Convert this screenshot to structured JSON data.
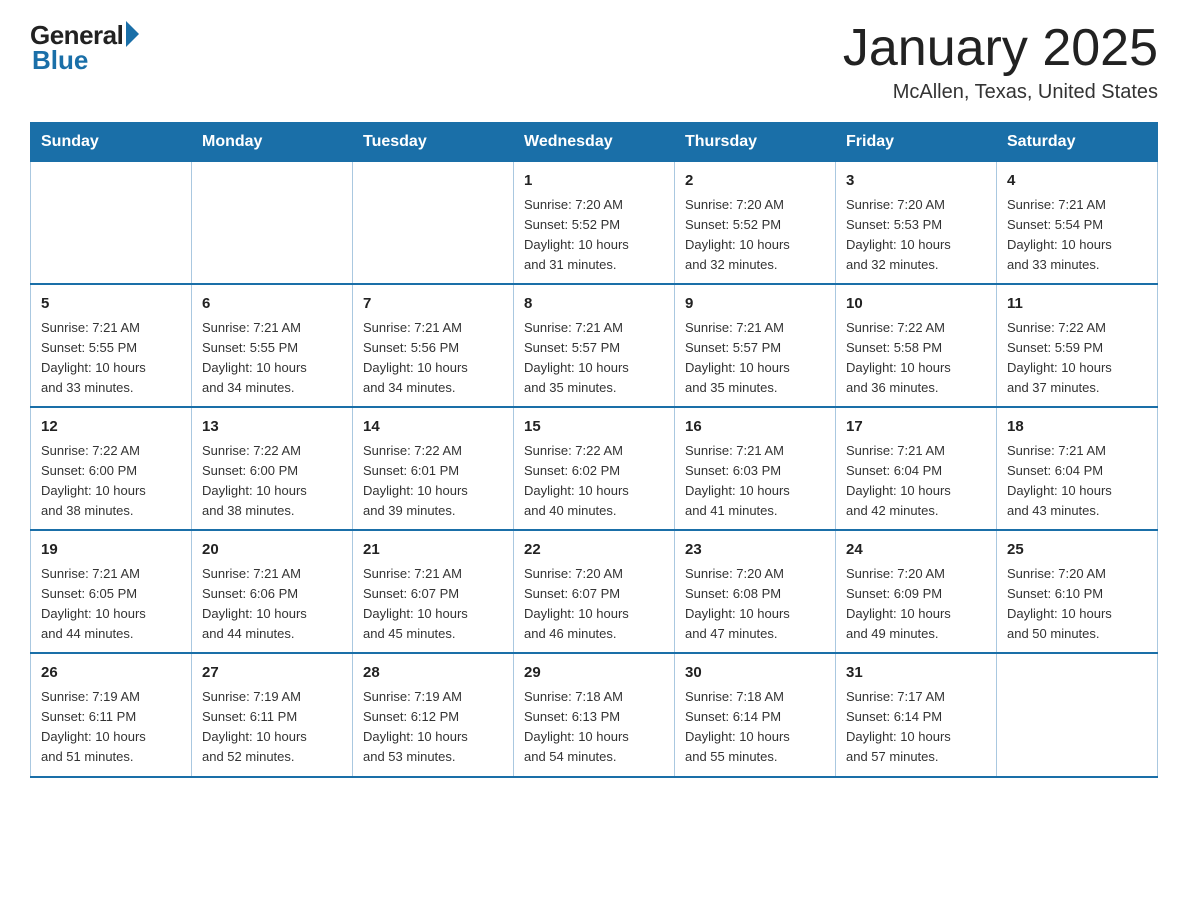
{
  "header": {
    "logo_general": "General",
    "logo_blue": "Blue",
    "main_title": "January 2025",
    "subtitle": "McAllen, Texas, United States"
  },
  "weekdays": [
    "Sunday",
    "Monday",
    "Tuesday",
    "Wednesday",
    "Thursday",
    "Friday",
    "Saturday"
  ],
  "weeks": [
    [
      {
        "day": "",
        "info": ""
      },
      {
        "day": "",
        "info": ""
      },
      {
        "day": "",
        "info": ""
      },
      {
        "day": "1",
        "info": "Sunrise: 7:20 AM\nSunset: 5:52 PM\nDaylight: 10 hours\nand 31 minutes."
      },
      {
        "day": "2",
        "info": "Sunrise: 7:20 AM\nSunset: 5:52 PM\nDaylight: 10 hours\nand 32 minutes."
      },
      {
        "day": "3",
        "info": "Sunrise: 7:20 AM\nSunset: 5:53 PM\nDaylight: 10 hours\nand 32 minutes."
      },
      {
        "day": "4",
        "info": "Sunrise: 7:21 AM\nSunset: 5:54 PM\nDaylight: 10 hours\nand 33 minutes."
      }
    ],
    [
      {
        "day": "5",
        "info": "Sunrise: 7:21 AM\nSunset: 5:55 PM\nDaylight: 10 hours\nand 33 minutes."
      },
      {
        "day": "6",
        "info": "Sunrise: 7:21 AM\nSunset: 5:55 PM\nDaylight: 10 hours\nand 34 minutes."
      },
      {
        "day": "7",
        "info": "Sunrise: 7:21 AM\nSunset: 5:56 PM\nDaylight: 10 hours\nand 34 minutes."
      },
      {
        "day": "8",
        "info": "Sunrise: 7:21 AM\nSunset: 5:57 PM\nDaylight: 10 hours\nand 35 minutes."
      },
      {
        "day": "9",
        "info": "Sunrise: 7:21 AM\nSunset: 5:57 PM\nDaylight: 10 hours\nand 35 minutes."
      },
      {
        "day": "10",
        "info": "Sunrise: 7:22 AM\nSunset: 5:58 PM\nDaylight: 10 hours\nand 36 minutes."
      },
      {
        "day": "11",
        "info": "Sunrise: 7:22 AM\nSunset: 5:59 PM\nDaylight: 10 hours\nand 37 minutes."
      }
    ],
    [
      {
        "day": "12",
        "info": "Sunrise: 7:22 AM\nSunset: 6:00 PM\nDaylight: 10 hours\nand 38 minutes."
      },
      {
        "day": "13",
        "info": "Sunrise: 7:22 AM\nSunset: 6:00 PM\nDaylight: 10 hours\nand 38 minutes."
      },
      {
        "day": "14",
        "info": "Sunrise: 7:22 AM\nSunset: 6:01 PM\nDaylight: 10 hours\nand 39 minutes."
      },
      {
        "day": "15",
        "info": "Sunrise: 7:22 AM\nSunset: 6:02 PM\nDaylight: 10 hours\nand 40 minutes."
      },
      {
        "day": "16",
        "info": "Sunrise: 7:21 AM\nSunset: 6:03 PM\nDaylight: 10 hours\nand 41 minutes."
      },
      {
        "day": "17",
        "info": "Sunrise: 7:21 AM\nSunset: 6:04 PM\nDaylight: 10 hours\nand 42 minutes."
      },
      {
        "day": "18",
        "info": "Sunrise: 7:21 AM\nSunset: 6:04 PM\nDaylight: 10 hours\nand 43 minutes."
      }
    ],
    [
      {
        "day": "19",
        "info": "Sunrise: 7:21 AM\nSunset: 6:05 PM\nDaylight: 10 hours\nand 44 minutes."
      },
      {
        "day": "20",
        "info": "Sunrise: 7:21 AM\nSunset: 6:06 PM\nDaylight: 10 hours\nand 44 minutes."
      },
      {
        "day": "21",
        "info": "Sunrise: 7:21 AM\nSunset: 6:07 PM\nDaylight: 10 hours\nand 45 minutes."
      },
      {
        "day": "22",
        "info": "Sunrise: 7:20 AM\nSunset: 6:07 PM\nDaylight: 10 hours\nand 46 minutes."
      },
      {
        "day": "23",
        "info": "Sunrise: 7:20 AM\nSunset: 6:08 PM\nDaylight: 10 hours\nand 47 minutes."
      },
      {
        "day": "24",
        "info": "Sunrise: 7:20 AM\nSunset: 6:09 PM\nDaylight: 10 hours\nand 49 minutes."
      },
      {
        "day": "25",
        "info": "Sunrise: 7:20 AM\nSunset: 6:10 PM\nDaylight: 10 hours\nand 50 minutes."
      }
    ],
    [
      {
        "day": "26",
        "info": "Sunrise: 7:19 AM\nSunset: 6:11 PM\nDaylight: 10 hours\nand 51 minutes."
      },
      {
        "day": "27",
        "info": "Sunrise: 7:19 AM\nSunset: 6:11 PM\nDaylight: 10 hours\nand 52 minutes."
      },
      {
        "day": "28",
        "info": "Sunrise: 7:19 AM\nSunset: 6:12 PM\nDaylight: 10 hours\nand 53 minutes."
      },
      {
        "day": "29",
        "info": "Sunrise: 7:18 AM\nSunset: 6:13 PM\nDaylight: 10 hours\nand 54 minutes."
      },
      {
        "day": "30",
        "info": "Sunrise: 7:18 AM\nSunset: 6:14 PM\nDaylight: 10 hours\nand 55 minutes."
      },
      {
        "day": "31",
        "info": "Sunrise: 7:17 AM\nSunset: 6:14 PM\nDaylight: 10 hours\nand 57 minutes."
      },
      {
        "day": "",
        "info": ""
      }
    ]
  ]
}
